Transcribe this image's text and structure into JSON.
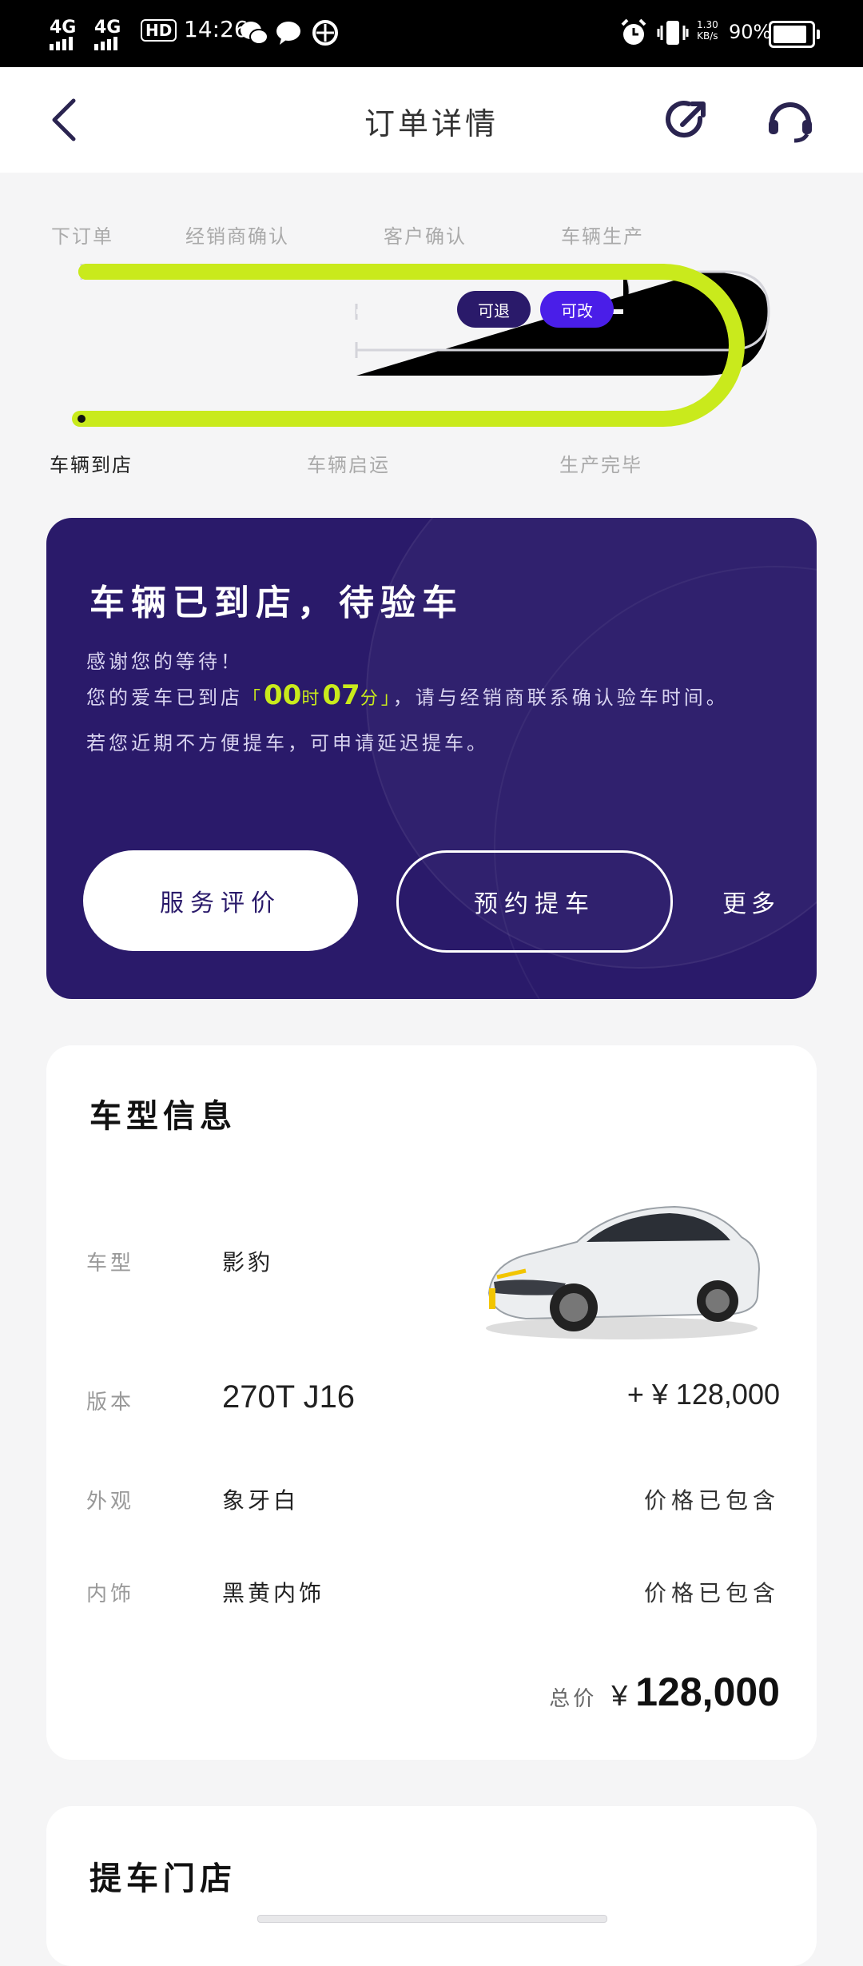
{
  "status_bar": {
    "network1": "4G",
    "network2": "4G",
    "hd": "HD",
    "time": "14:26",
    "speed": "1.30",
    "speed_unit": "KB/s",
    "battery": "90%",
    "battery_level": 0.9
  },
  "header": {
    "title": "订单详情"
  },
  "progress": {
    "steps_top": [
      "下订单",
      "经销商确认",
      "客户确认",
      "车辆生产"
    ],
    "steps_bottom": [
      "车辆到店",
      "车辆启运",
      "生产完毕"
    ],
    "pill_back": "可退",
    "pill_change": "可改",
    "accent_color": "#c9ea1c"
  },
  "status_card": {
    "title": "车辆已到店，待验车",
    "line1": "感谢您的等待！",
    "line2_prefix": "您的爱车已到店",
    "countdown_open": "「",
    "countdown_hours": "00",
    "countdown_h_unit": "时",
    "countdown_minutes": "07",
    "countdown_m_unit": "分",
    "countdown_close": "」",
    "line2_suffix": "，请与经销商联系确认验车时间。",
    "line3": "若您近期不方便提车，可申请延迟提车。",
    "btn_evaluate": "服务评价",
    "btn_pickup": "预约提车",
    "btn_more": "更多",
    "bg_color": "#2a1a6a"
  },
  "vehicle_card": {
    "title": "车型信息",
    "model_label": "车型",
    "model_value": "影豹",
    "version_label": "版本",
    "version_value": "270T J16",
    "version_price": "+ ¥ 128,000",
    "exterior_label": "外观",
    "exterior_value": "象牙白",
    "exterior_note": "价格已包含",
    "interior_label": "内饰",
    "interior_value": "黑黄内饰",
    "interior_note": "价格已包含",
    "total_label": "总价",
    "total_currency": "¥",
    "total_value": "128,000"
  },
  "pickup_card": {
    "title": "提车门店"
  }
}
